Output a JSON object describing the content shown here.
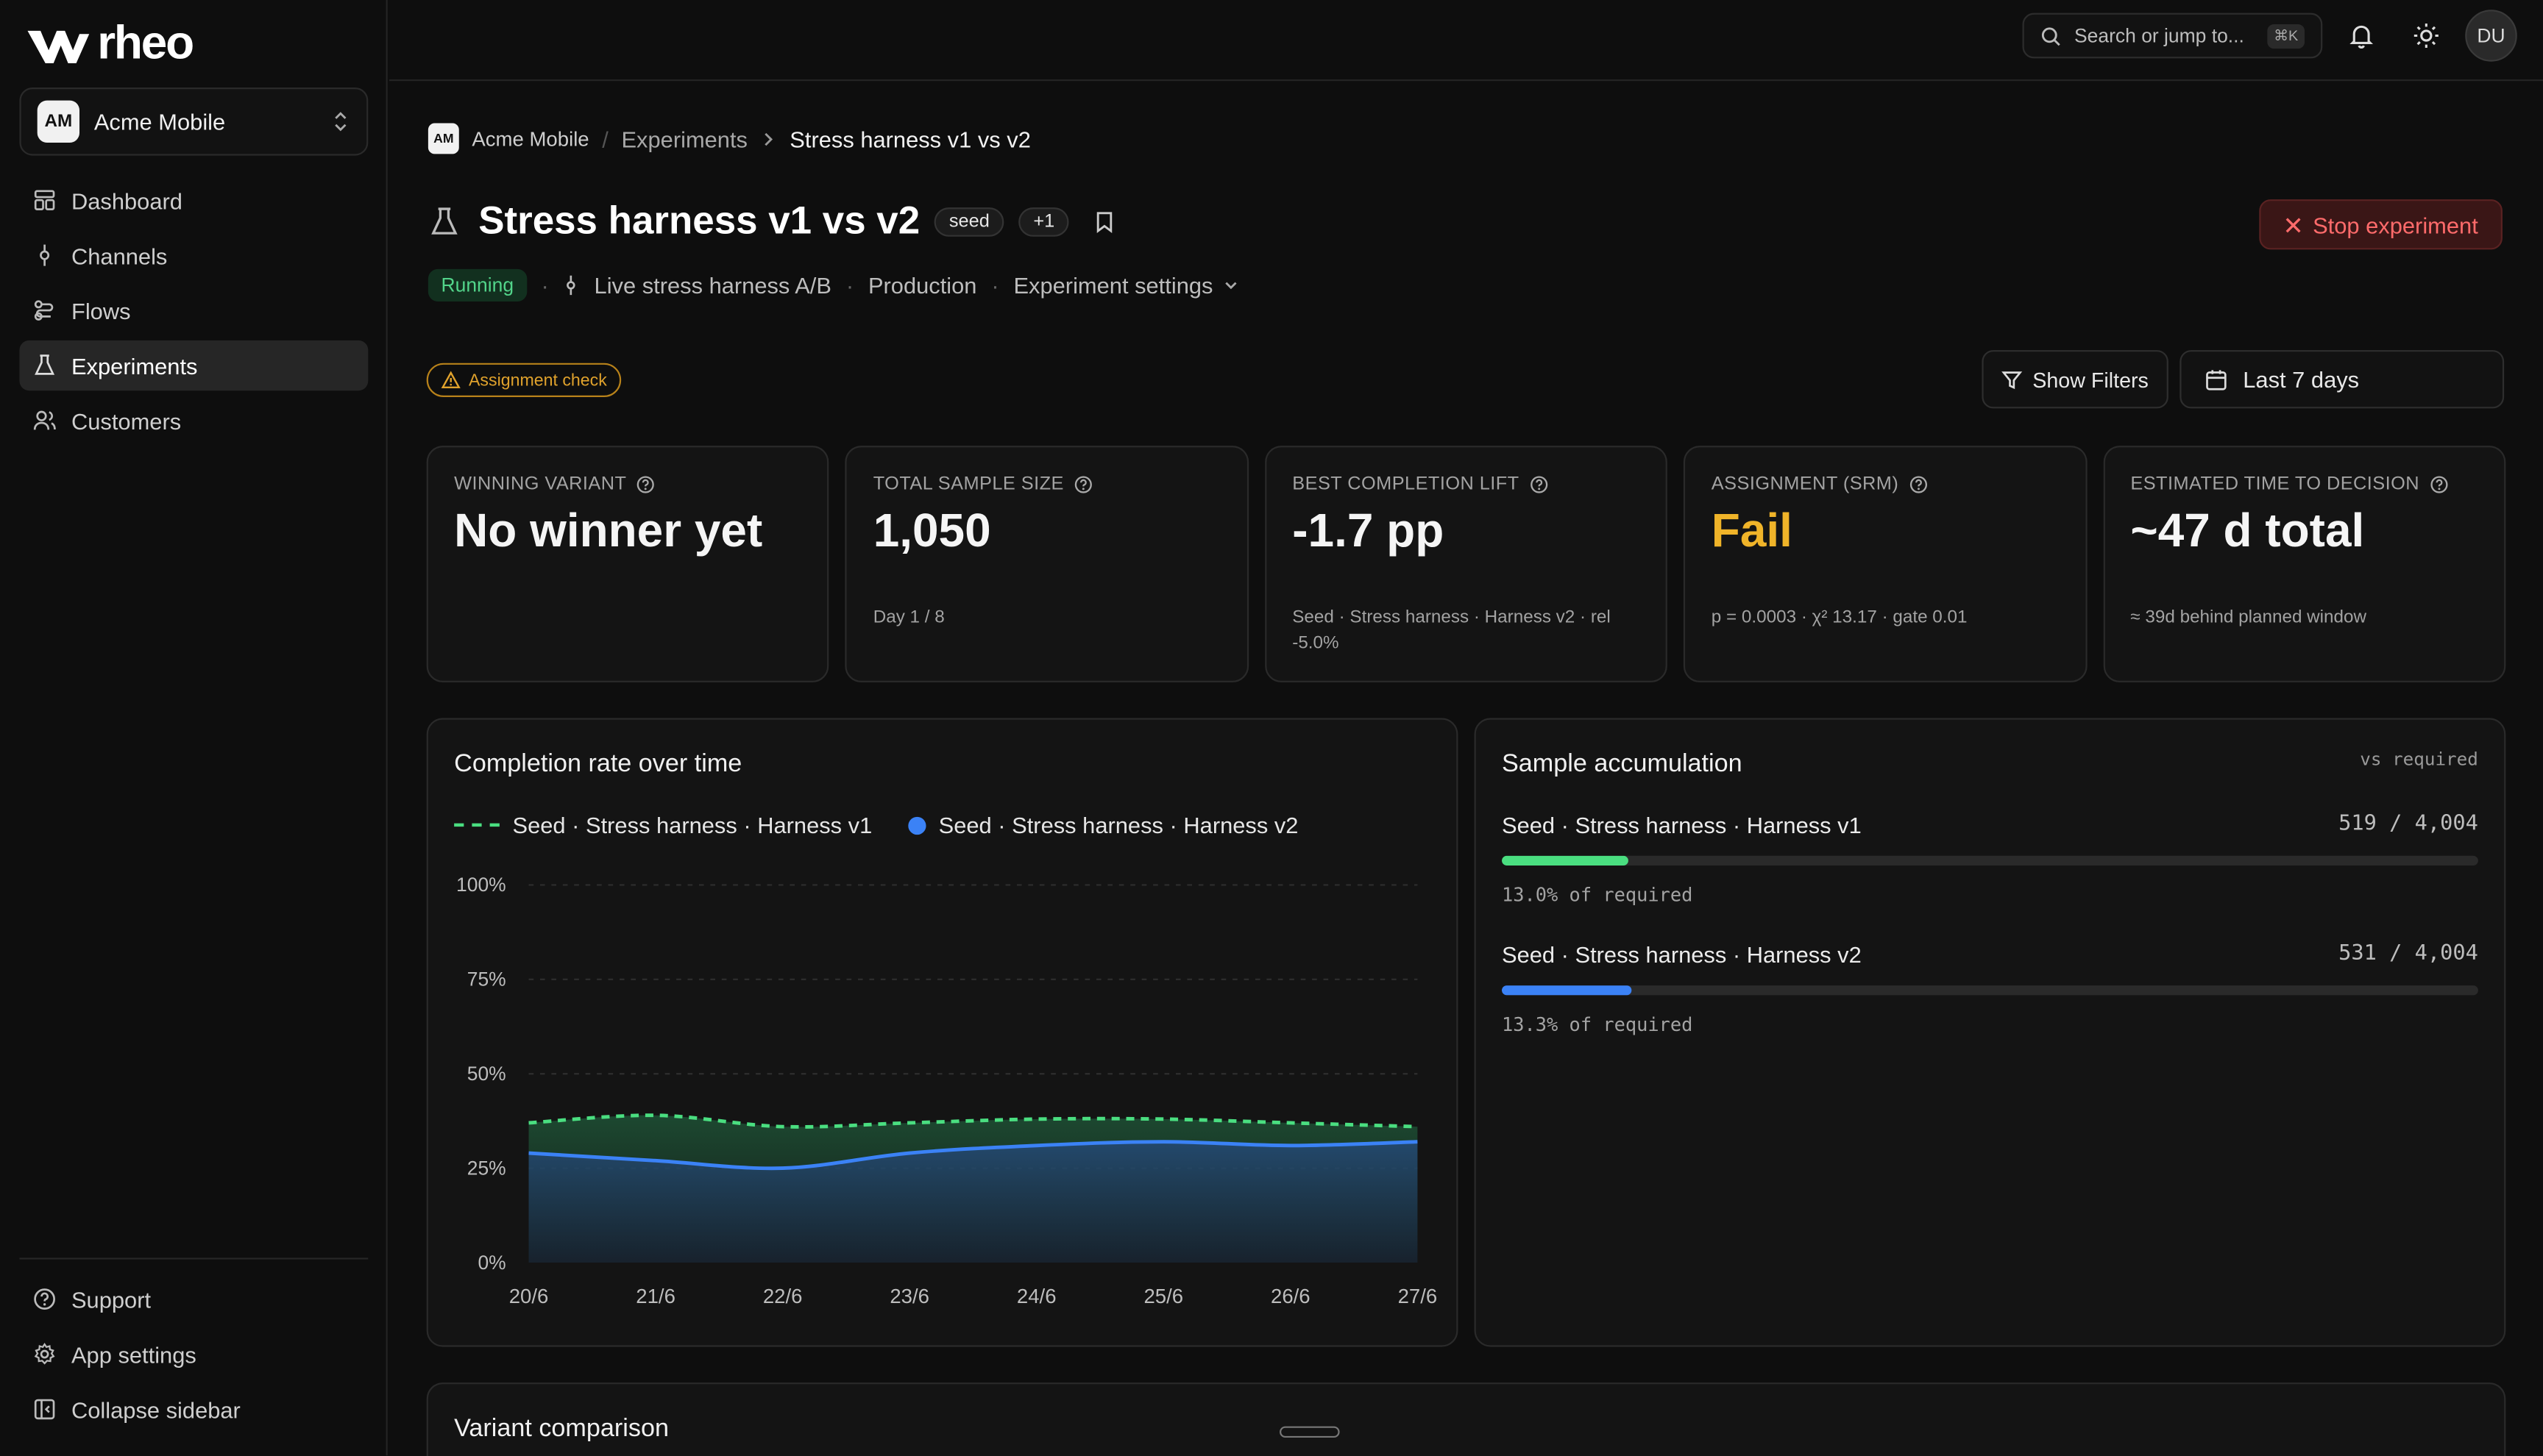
{
  "app": {
    "logo_text": "rheo"
  },
  "org": {
    "initials": "AM",
    "name": "Acme Mobile"
  },
  "sidebar": {
    "items": [
      {
        "label": "Dashboard",
        "icon": "dashboard-icon"
      },
      {
        "label": "Channels",
        "icon": "channels-icon"
      },
      {
        "label": "Flows",
        "icon": "flows-icon"
      },
      {
        "label": "Experiments",
        "icon": "flask-icon",
        "active": true
      },
      {
        "label": "Customers",
        "icon": "users-icon"
      }
    ],
    "bottom": [
      {
        "label": "Support",
        "icon": "help-icon"
      },
      {
        "label": "App settings",
        "icon": "gear-icon"
      },
      {
        "label": "Collapse sidebar",
        "icon": "collapse-icon"
      }
    ]
  },
  "topbar": {
    "search_placeholder": "Search or jump to...",
    "shortcut": "⌘K",
    "user_initials": "DU"
  },
  "breadcrumb": {
    "org_initials": "AM",
    "org": "Acme Mobile",
    "section": "Experiments",
    "current": "Stress harness v1 vs v2"
  },
  "experiment": {
    "title": "Stress harness v1 vs v2",
    "tag": "seed",
    "extra_tags": "+1",
    "status": "Running",
    "flow": "Live stress harness A/B",
    "environment": "Production",
    "settings_label": "Experiment settings",
    "stop_label": "Stop experiment",
    "assignment_check": "Assignment check",
    "filters_label": "Show Filters",
    "date_range": "Last 7 days"
  },
  "kpis": [
    {
      "label": "WINNING VARIANT",
      "value": "No winner yet",
      "sub": ""
    },
    {
      "label": "TOTAL SAMPLE SIZE",
      "value": "1,050",
      "sub": "Day 1 / 8"
    },
    {
      "label": "BEST COMPLETION LIFT",
      "value": "-1.7 pp",
      "sub": "Seed · Stress harness · Harness v2 · rel -5.0%"
    },
    {
      "label": "ASSIGNMENT (SRM)",
      "value": "Fail",
      "sub": "p = 0.0003 · χ² 13.17 · gate 0.01"
    },
    {
      "label": "ESTIMATED TIME TO DECISION",
      "value": "~47 d total",
      "sub": "≈ 39d behind planned window"
    }
  ],
  "completion_card": {
    "title": "Completion rate over time"
  },
  "chart_data": {
    "type": "area",
    "title": "Completion rate over time",
    "categories": [
      "20/6",
      "21/6",
      "22/6",
      "23/6",
      "24/6",
      "25/6",
      "26/6",
      "27/6"
    ],
    "y_ticks": [
      "100%",
      "75%",
      "50%",
      "25%",
      "0%"
    ],
    "ylim": [
      0,
      100
    ],
    "grid": true,
    "legend_position": "top-left",
    "series": [
      {
        "name": "Seed · Stress harness · Harness v1",
        "values": [
          37,
          39,
          36,
          37,
          38,
          38,
          37,
          36
        ],
        "color": "#4ade80",
        "style": "dashed"
      },
      {
        "name": "Seed · Stress harness · Harness v2",
        "values": [
          29,
          27,
          25,
          29,
          31,
          32,
          31,
          32
        ],
        "color": "#3b82f6",
        "style": "solid"
      }
    ]
  },
  "accumulation": {
    "title": "Sample accumulation",
    "vs_label": "vs required",
    "rows": [
      {
        "name": "Seed · Stress harness · Harness v1",
        "count": "519  /  4,004",
        "fraction": 0.13,
        "pct": "13.0% of required",
        "color": "#4ade80"
      },
      {
        "name": "Seed · Stress harness · Harness v2",
        "count": "531  /  4,004",
        "fraction": 0.133,
        "pct": "13.3% of required",
        "color": "#3b82f6"
      }
    ]
  },
  "comparison": {
    "title": "Variant comparison"
  }
}
